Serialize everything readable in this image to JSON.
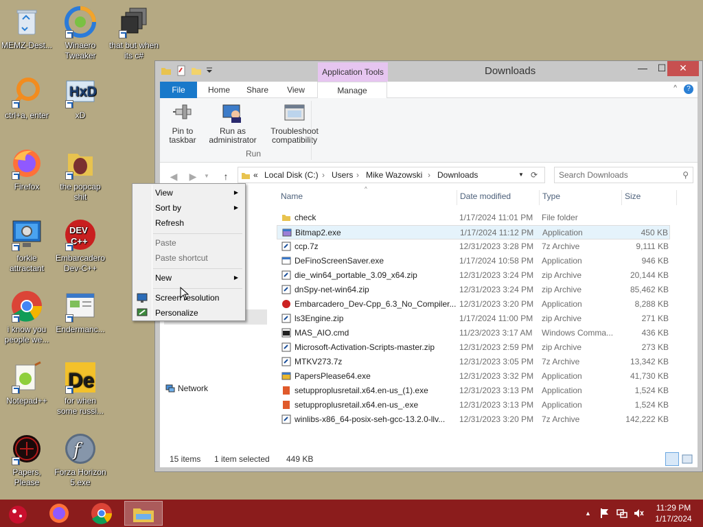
{
  "desktop": {
    "icons": [
      {
        "label": "MEMZ-Dest...",
        "icon": "recycle-bin-icon"
      },
      {
        "label": "Winaero Tweaker",
        "icon": "winaero-icon"
      },
      {
        "label": "that but when its c#",
        "icon": "folder-stack-icon"
      },
      {
        "label": "ctrl+a, enter",
        "icon": "magnifier-icon"
      },
      {
        "label": "xD",
        "icon": "hxd-icon"
      },
      {
        "label": "Firefox",
        "icon": "firefox-icon"
      },
      {
        "label": "the popcap shit",
        "icon": "popcap-icon"
      },
      {
        "label": "forkie attractant",
        "icon": "computer-gear-icon"
      },
      {
        "label": "Embarcadero Dev-C++",
        "icon": "devcpp-icon"
      },
      {
        "label": "i know you people we...",
        "icon": "chrome-icon"
      },
      {
        "label": "Endermanc...",
        "icon": "screenshot-icon"
      },
      {
        "label": "Notepad++",
        "icon": "notepad-plus-plus-icon"
      },
      {
        "label": "for when some russi...",
        "icon": "de-icon"
      },
      {
        "label": "Papers, Please",
        "icon": "papers-please-icon"
      },
      {
        "label": "Forza Horizon 5.exe",
        "icon": "flash-icon"
      }
    ]
  },
  "explorer": {
    "title": "Downloads",
    "app_tools_label": "Application Tools",
    "tabs": {
      "file": "File",
      "home": "Home",
      "share": "Share",
      "view": "View",
      "manage": "Manage"
    },
    "ribbon": {
      "pin": "Pin to taskbar",
      "run_admin": "Run as administrator",
      "troubleshoot": "Troubleshoot compatibility",
      "group_label": "Run"
    },
    "address": {
      "prefix": "«",
      "crumbs": [
        "Local Disk (C:)",
        "Users",
        "Mike Wazowski",
        "Downloads"
      ]
    },
    "search_placeholder": "Search Downloads",
    "nav_items": {
      "network": "Network"
    },
    "columns": {
      "name": "Name",
      "date": "Date modified",
      "type": "Type",
      "size": "Size"
    },
    "files": [
      {
        "name": "check",
        "date": "1/17/2024 11:01 PM",
        "type": "File folder",
        "size": "",
        "icon": "folder-icon",
        "color": "#e8c34f"
      },
      {
        "name": "Bitmap2.exe",
        "date": "1/17/2024 11:12 PM",
        "type": "Application",
        "size": "450 KB",
        "icon": "app-icon",
        "color": "#9b7fd6",
        "selected": true
      },
      {
        "name": "ccp.7z",
        "date": "12/31/2023 3:28 PM",
        "type": "7z Archive",
        "size": "9,111 KB",
        "icon": "archive-icon",
        "color": "#ffffff"
      },
      {
        "name": "DeFinoScreenSaver.exe",
        "date": "1/17/2024 10:58 PM",
        "type": "Application",
        "size": "946 KB",
        "icon": "app-icon",
        "color": "#ffffff"
      },
      {
        "name": "die_win64_portable_3.09_x64.zip",
        "date": "12/31/2023 3:24 PM",
        "type": "zip Archive",
        "size": "20,144 KB",
        "icon": "archive-icon",
        "color": "#ffffff"
      },
      {
        "name": "dnSpy-net-win64.zip",
        "date": "12/31/2023 3:24 PM",
        "type": "zip Archive",
        "size": "85,462 KB",
        "icon": "archive-icon",
        "color": "#ffffff"
      },
      {
        "name": "Embarcadero_Dev-Cpp_6.3_No_Compiler...",
        "date": "12/31/2023 3:20 PM",
        "type": "Application",
        "size": "8,288 KB",
        "icon": "devcpp-icon",
        "color": "#cc2222"
      },
      {
        "name": "ls3Engine.zip",
        "date": "1/17/2024 11:00 PM",
        "type": "zip Archive",
        "size": "271 KB",
        "icon": "archive-icon",
        "color": "#ffffff"
      },
      {
        "name": "MAS_AIO.cmd",
        "date": "11/23/2023 3:17 AM",
        "type": "Windows Comma...",
        "size": "436 KB",
        "icon": "cmd-icon",
        "color": "#ffffff"
      },
      {
        "name": "Microsoft-Activation-Scripts-master.zip",
        "date": "12/31/2023 2:59 PM",
        "type": "zip Archive",
        "size": "273 KB",
        "icon": "archive-icon",
        "color": "#ffffff"
      },
      {
        "name": "MTKV273.7z",
        "date": "12/31/2023 3:05 PM",
        "type": "7z Archive",
        "size": "13,342 KB",
        "icon": "archive-icon",
        "color": "#ffffff"
      },
      {
        "name": "PapersPlease64.exe",
        "date": "12/31/2023 3:32 PM",
        "type": "Application",
        "size": "41,730 KB",
        "icon": "app-icon",
        "color": "#e8b830"
      },
      {
        "name": "setupproplusretail.x64.en-us_(1).exe",
        "date": "12/31/2023 3:13 PM",
        "type": "Application",
        "size": "1,524 KB",
        "icon": "office-icon",
        "color": "#e05a2b"
      },
      {
        "name": "setupproplusretail.x64.en-us_.exe",
        "date": "12/31/2023 3:13 PM",
        "type": "Application",
        "size": "1,524 KB",
        "icon": "office-icon",
        "color": "#e05a2b"
      },
      {
        "name": "winlibs-x86_64-posix-seh-gcc-13.2.0-llv...",
        "date": "12/31/2023 3:20 PM",
        "type": "7z Archive",
        "size": "142,222 KB",
        "icon": "archive-icon",
        "color": "#ffffff"
      }
    ],
    "status": {
      "count": "15 items",
      "selected": "1 item selected",
      "size": "449 KB"
    }
  },
  "context_menu": {
    "view": "View",
    "sort_by": "Sort by",
    "refresh": "Refresh",
    "paste": "Paste",
    "paste_shortcut": "Paste shortcut",
    "new": "New",
    "screen_resolution": "Screen resolution",
    "personalize": "Personalize"
  },
  "taskbar": {
    "time": "11:29 PM",
    "date": "1/17/2024",
    "color": "#8b1c1c"
  }
}
